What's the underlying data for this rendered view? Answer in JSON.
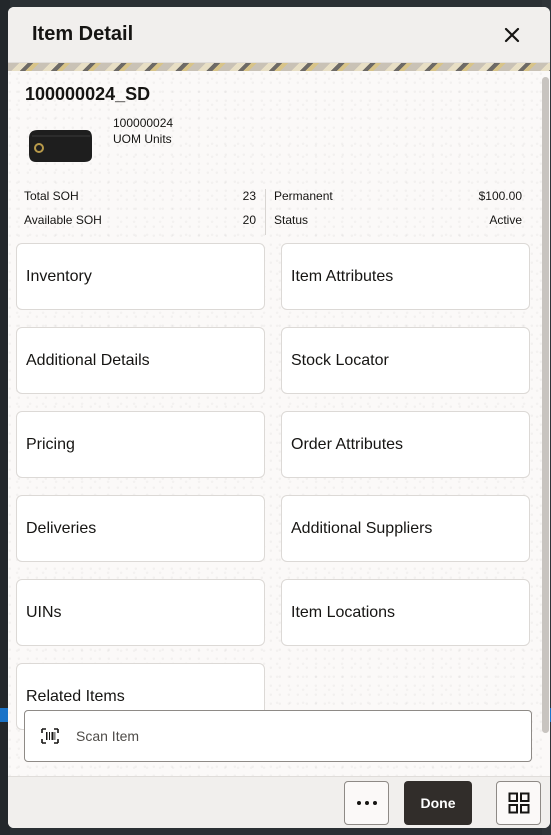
{
  "dialog": {
    "title": "Item Detail"
  },
  "item": {
    "id": "100000024_SD",
    "sub_id": "100000024",
    "uom": "UOM Units"
  },
  "stats": {
    "total_soh_label": "Total SOH",
    "total_soh_value": "23",
    "available_soh_label": "Available SOH",
    "available_soh_value": "20",
    "permanent_label": "Permanent",
    "permanent_value": "$100.00",
    "status_label": "Status",
    "status_value": "Active"
  },
  "tiles": [
    {
      "label": "Inventory"
    },
    {
      "label": "Item Attributes"
    },
    {
      "label": "Additional Details"
    },
    {
      "label": "Stock Locator"
    },
    {
      "label": "Pricing"
    },
    {
      "label": "Order Attributes"
    },
    {
      "label": "Deliveries"
    },
    {
      "label": "Additional Suppliers"
    },
    {
      "label": "UINs"
    },
    {
      "label": "Item Locations"
    },
    {
      "label": "Related Items"
    }
  ],
  "scan": {
    "label": "Scan Item"
  },
  "footer": {
    "done_label": "Done"
  },
  "colors": {
    "done_bg": "#312d2a",
    "dialog_bg": "#fbf9f8",
    "header_bg": "#f1efed"
  }
}
